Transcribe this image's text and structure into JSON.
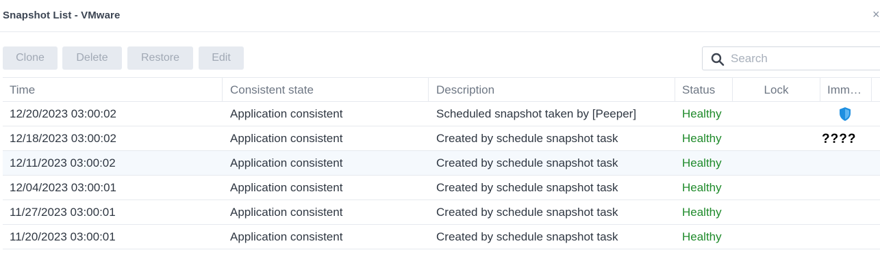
{
  "window": {
    "title": "Snapshot List - VMware",
    "close_glyph": "×"
  },
  "toolbar": {
    "clone_label": "Clone",
    "delete_label": "Delete",
    "restore_label": "Restore",
    "edit_label": "Edit"
  },
  "search": {
    "placeholder": "Search",
    "value": ""
  },
  "table": {
    "columns": [
      "Time",
      "Consistent state",
      "Description",
      "Status",
      "Lock",
      "Imm…"
    ],
    "rows": [
      {
        "time": "12/20/2023 03:00:02",
        "state": "Application consistent",
        "description": "Scheduled snapshot taken by [Peeper]",
        "status": "Healthy",
        "lock": "",
        "immutable": "shield-icon"
      },
      {
        "time": "12/18/2023 03:00:02",
        "state": "Application consistent",
        "description": "Created by schedule snapshot task",
        "status": "Healthy",
        "lock": "",
        "immutable": "????"
      },
      {
        "time": "12/11/2023 03:00:02",
        "state": "Application consistent",
        "description": "Created by schedule snapshot task",
        "status": "Healthy",
        "lock": "",
        "immutable": ""
      },
      {
        "time": "12/04/2023 03:00:01",
        "state": "Application consistent",
        "description": "Created by schedule snapshot task",
        "status": "Healthy",
        "lock": "",
        "immutable": ""
      },
      {
        "time": "11/27/2023 03:00:01",
        "state": "Application consistent",
        "description": "Created by schedule snapshot task",
        "status": "Healthy",
        "lock": "",
        "immutable": ""
      },
      {
        "time": "11/20/2023 03:00:01",
        "state": "Application consistent",
        "description": "Created by schedule snapshot task",
        "status": "Healthy",
        "lock": "",
        "immutable": ""
      }
    ]
  },
  "colors": {
    "healthy": "#1e8a2a",
    "shield": "#1e8fe0",
    "selected_row": "#f5f9fd",
    "button_bg": "#e6eaf0"
  }
}
